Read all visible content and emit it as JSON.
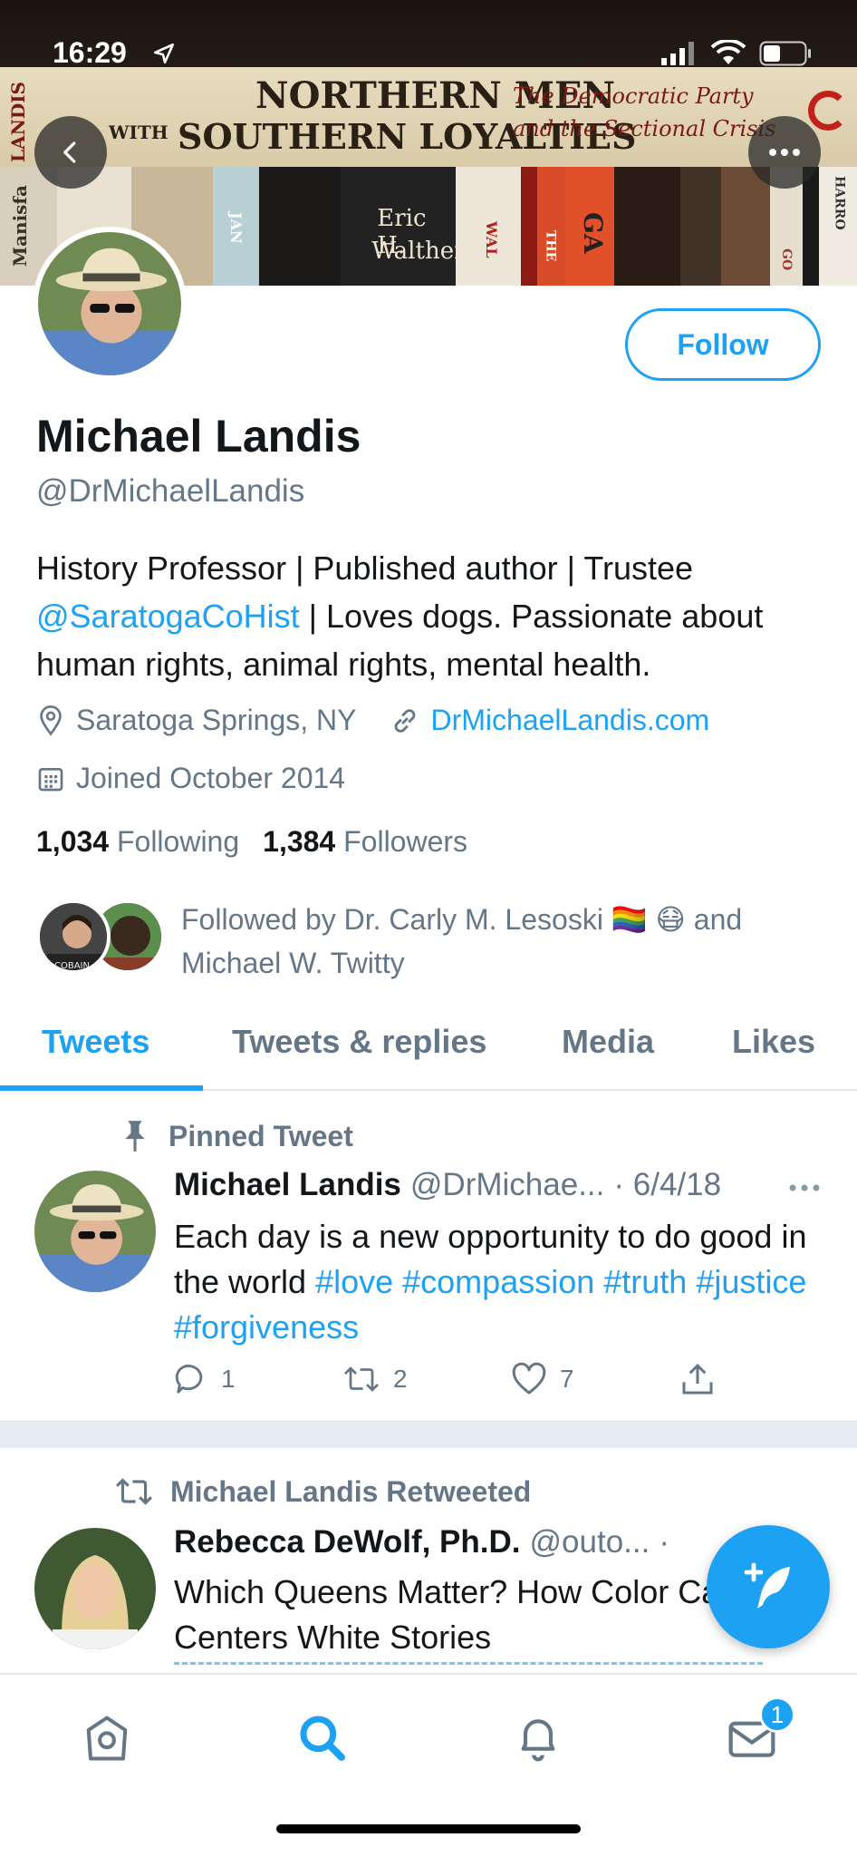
{
  "status_bar": {
    "time": "16:29"
  },
  "banner": {
    "book_title_line1": "NORTHERN MEN",
    "book_title_line2": "SOUTHERN LOYALTIES",
    "book_with": "WITH",
    "book_subtitle_1": "The Democratic Party",
    "book_subtitle_2": "and the Sectional Crisis",
    "book_spine_author_1": "LANDIS",
    "book2_author_l1": "Eric H.",
    "book2_author_l2": "Walther",
    "spine_left": "Manisfa",
    "spine_ga": "GA",
    "spine_the": "THE",
    "spine_wal": "WAL",
    "spine_go": "GO",
    "spine_harro": "HARRO",
    "spine_jan": "JAN"
  },
  "profile": {
    "name": "Michael Landis",
    "handle": "@DrMichaelLandis",
    "follow_label": "Follow",
    "bio_line_pre": "History Professor | Published author | Trustee ",
    "bio_link": "@SaratogaCoHist",
    "bio_post": " | Loves dogs. Passionate about human rights, animal rights, mental health.",
    "location": "Saratoga Springs, NY",
    "website": "DrMichaelLandis.com",
    "joined": "Joined October 2014",
    "following_count": "1,034",
    "following_label": "Following",
    "followers_count": "1,384",
    "followers_label": "Followers",
    "followed_by_text": "Followed by Dr. Carly M. Lesoski 🏳️‍🌈 😷 and Michael W. Twitty",
    "followed_by_avatar_text": "COBAIN"
  },
  "tabs": [
    "Tweets",
    "Tweets & replies",
    "Media",
    "Likes"
  ],
  "tweets": [
    {
      "context": "Pinned Tweet",
      "author": "Michael Landis",
      "handle": "@DrMichae...",
      "date": "· 6/4/18",
      "text_pre": "Each day is a new opportunity to do good in the world ",
      "hashtags": "#love #compassion #truth #justice #forgiveness",
      "replies": "1",
      "retweets": "2",
      "likes": "7"
    },
    {
      "context": "Michael Landis Retweeted",
      "author": "Rebecca DeWolf, Ph.D.",
      "handle": "@outo...",
      "date": "·",
      "text": "Which Queens Matter? How Color Casting Centers White Stories"
    }
  ],
  "bottom_nav": {
    "messages_badge": "1"
  },
  "colors": {
    "accent": "#1da1f2",
    "secondary_text": "#657786"
  }
}
